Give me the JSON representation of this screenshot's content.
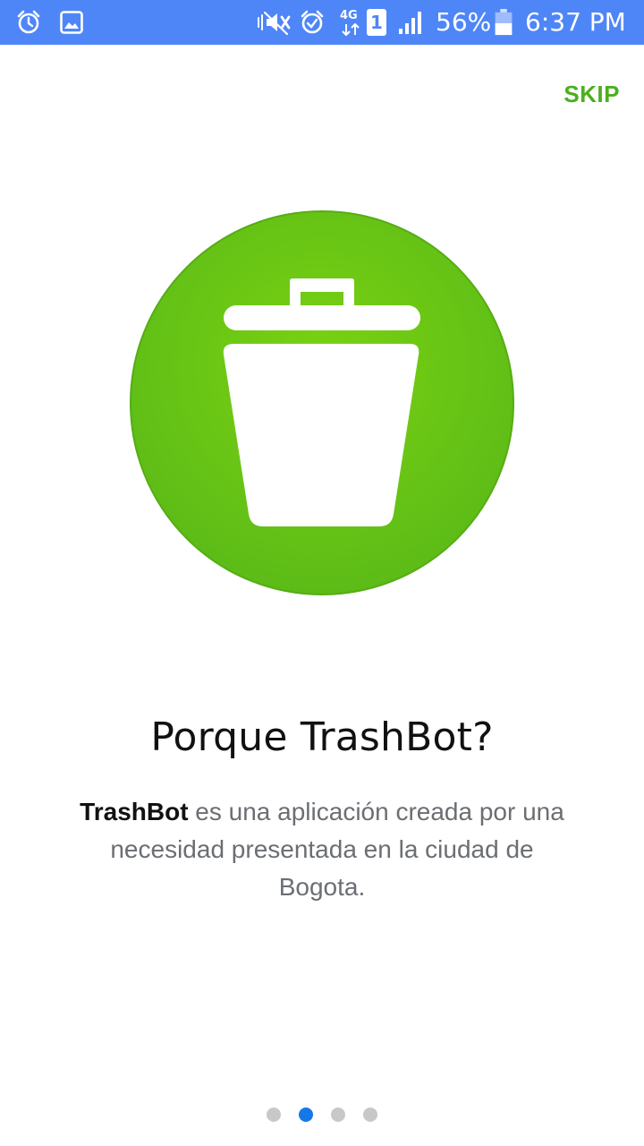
{
  "status_bar": {
    "battery_percent": "56%",
    "time": "6:37 PM",
    "network_label": "4G",
    "sim_label": "1",
    "icons": [
      "alarm-icon",
      "gallery-icon",
      "mute-icon",
      "alarm-icon",
      "network-4g-icon",
      "sim-icon",
      "signal-icon",
      "battery-icon"
    ],
    "background_color": "#4f86f7"
  },
  "onboarding": {
    "skip_label": "SKIP",
    "hero_icon": "trash-can-icon",
    "hero_color": "#66c614",
    "title": "Porque TrashBot?",
    "description_brand": "TrashBot",
    "description_rest": " es una aplicación creada por una necesidad presentada en la ciudad de Bogota.",
    "accent_color": "#4caf1f"
  },
  "pager": {
    "pages": 4,
    "current_page": 2,
    "active_color": "#1677e8"
  }
}
